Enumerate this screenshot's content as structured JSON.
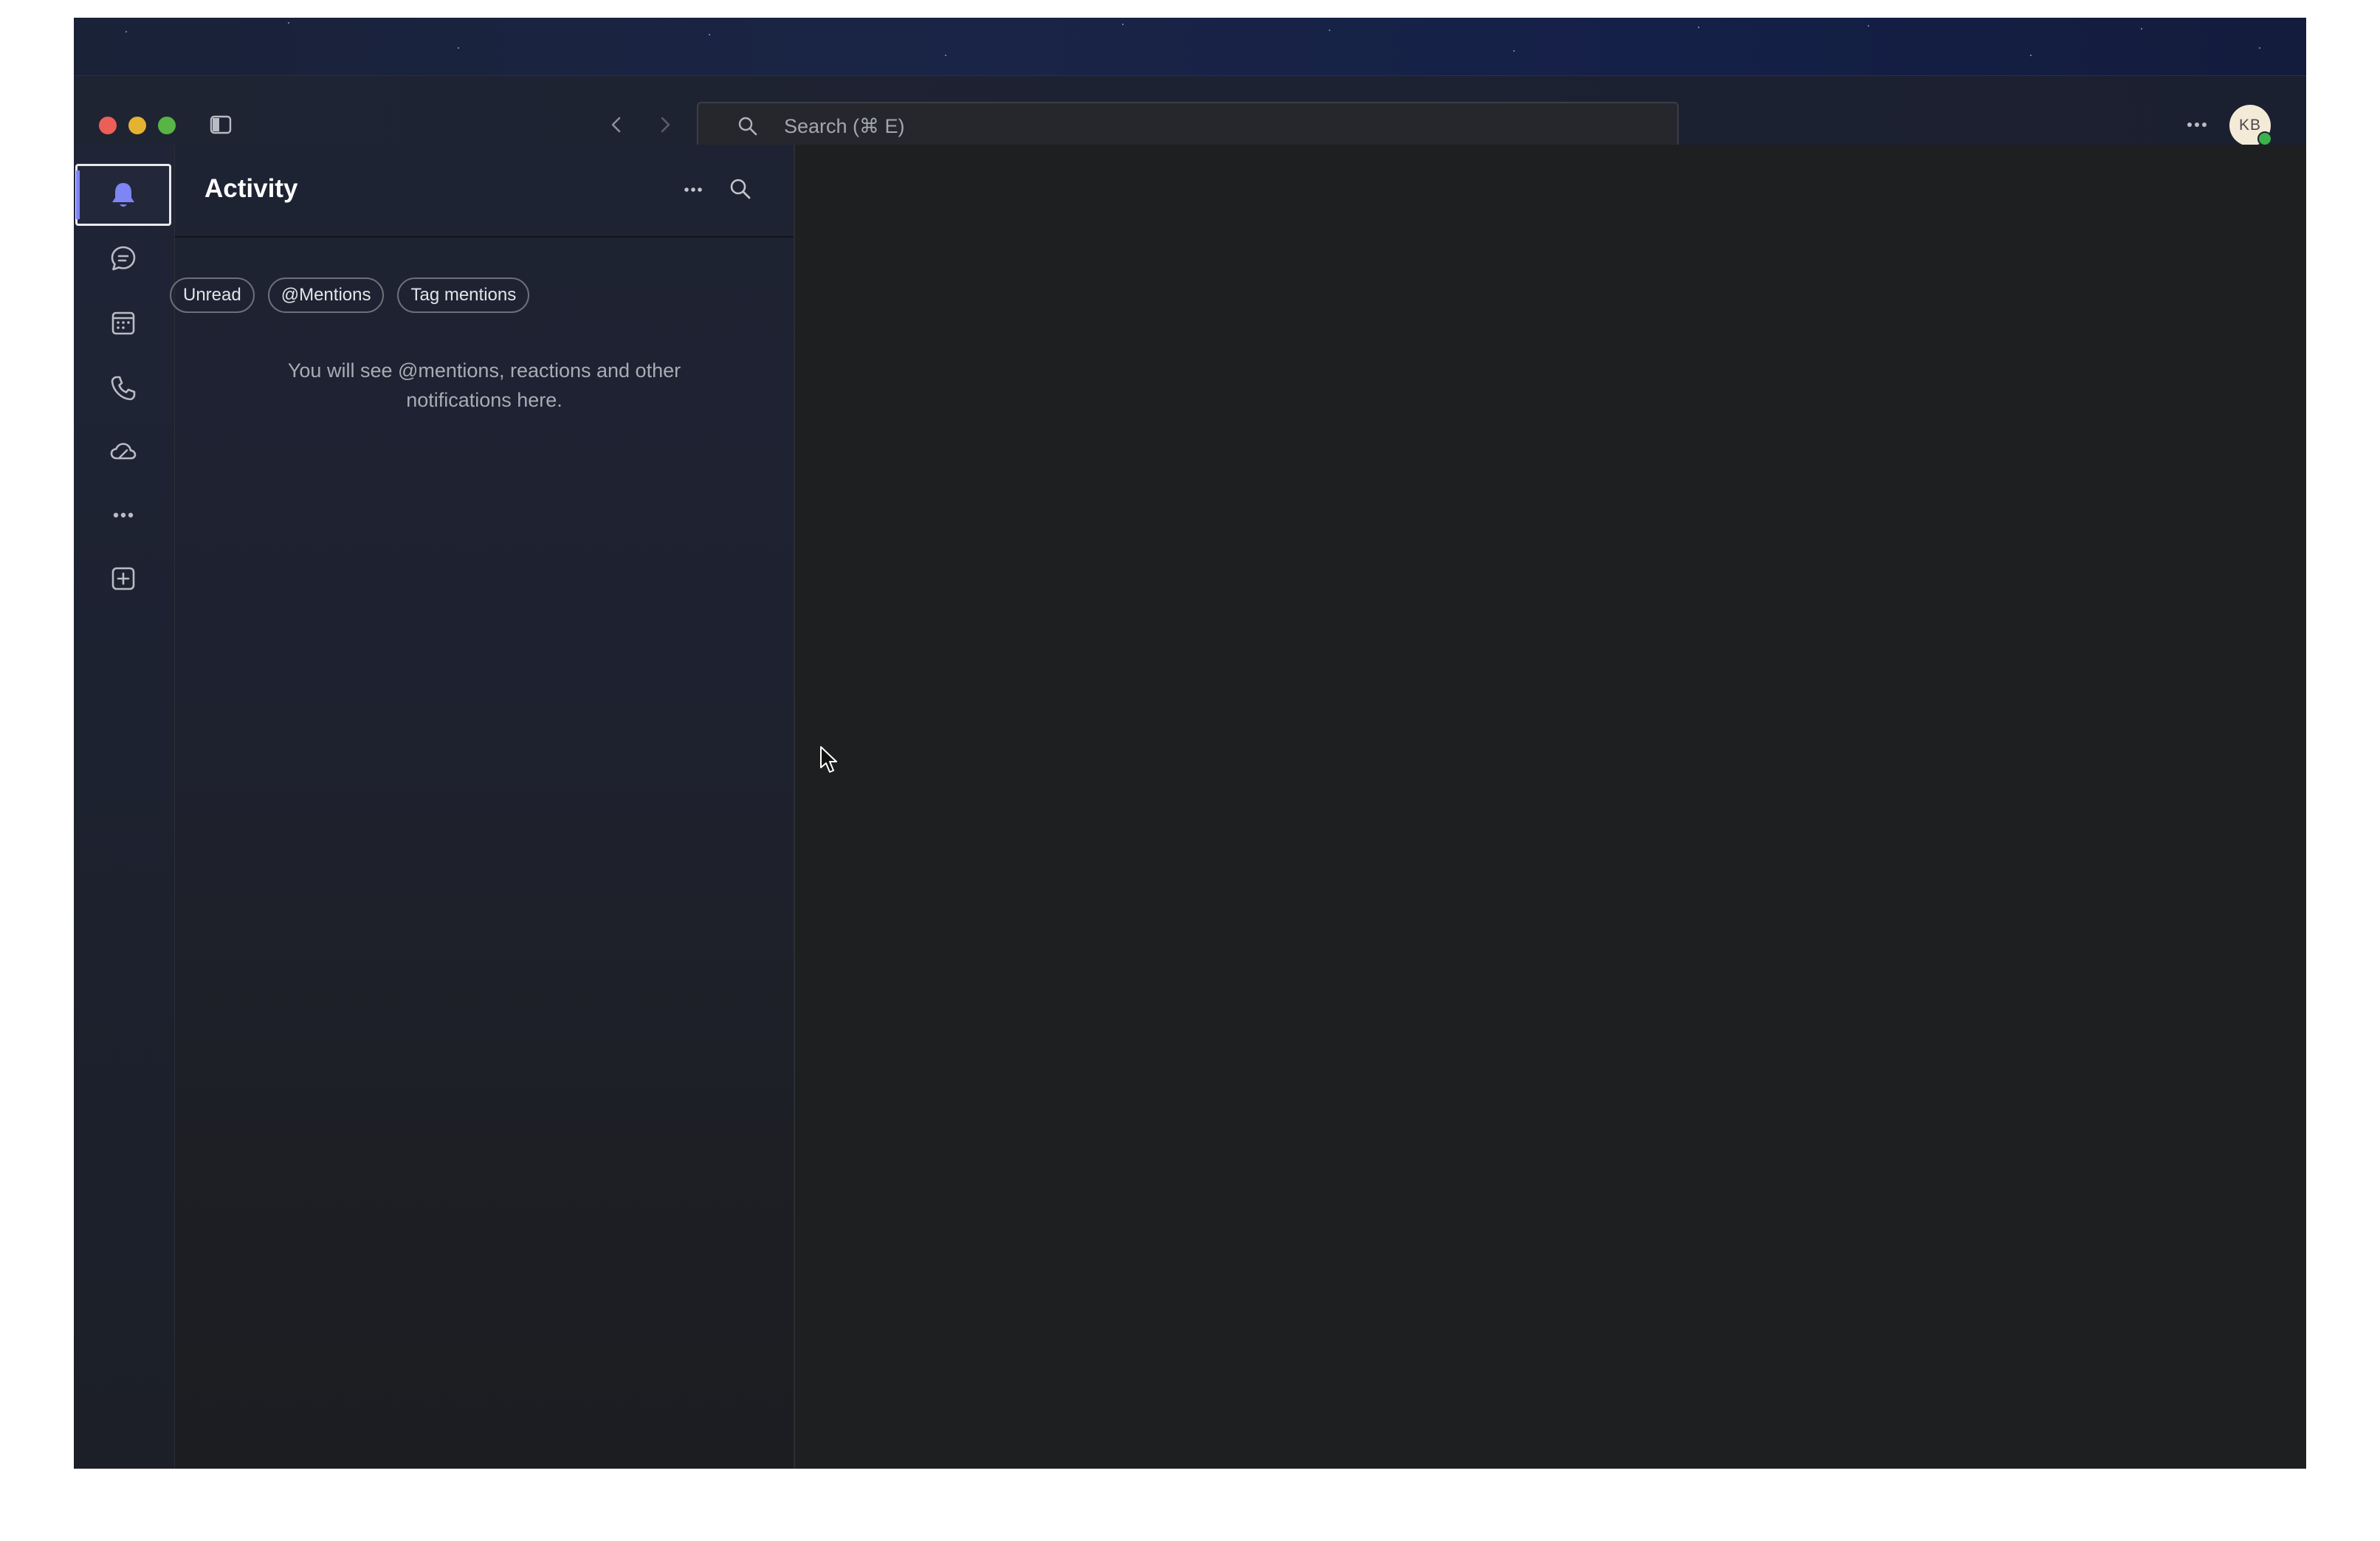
{
  "window": {
    "search_placeholder": "Search (⌘ E)",
    "avatar_initials": "KB"
  },
  "rail": {
    "items": [
      {
        "icon": "bell-icon",
        "label": "Activity",
        "active": true
      },
      {
        "icon": "chat-icon",
        "label": "Chat"
      },
      {
        "icon": "calendar-icon",
        "label": "Calendar"
      },
      {
        "icon": "phone-icon",
        "label": "Calls"
      },
      {
        "icon": "cloud-icon",
        "label": "OneDrive"
      },
      {
        "icon": "more-horizontal-icon",
        "label": "More apps"
      },
      {
        "icon": "add-app-icon",
        "label": "Apps"
      }
    ]
  },
  "panel": {
    "title": "Activity",
    "filters": [
      "Unread",
      "@Mentions",
      "Tag mentions"
    ],
    "empty_line1": "You will see @mentions, reactions and other",
    "empty_line2": "notifications here."
  },
  "colors": {
    "accent": "#7f85f5",
    "presence": "#3bb24a",
    "traffic_red": "#ec5f57",
    "traffic_yellow": "#e5b332",
    "traffic_green": "#58b545"
  }
}
